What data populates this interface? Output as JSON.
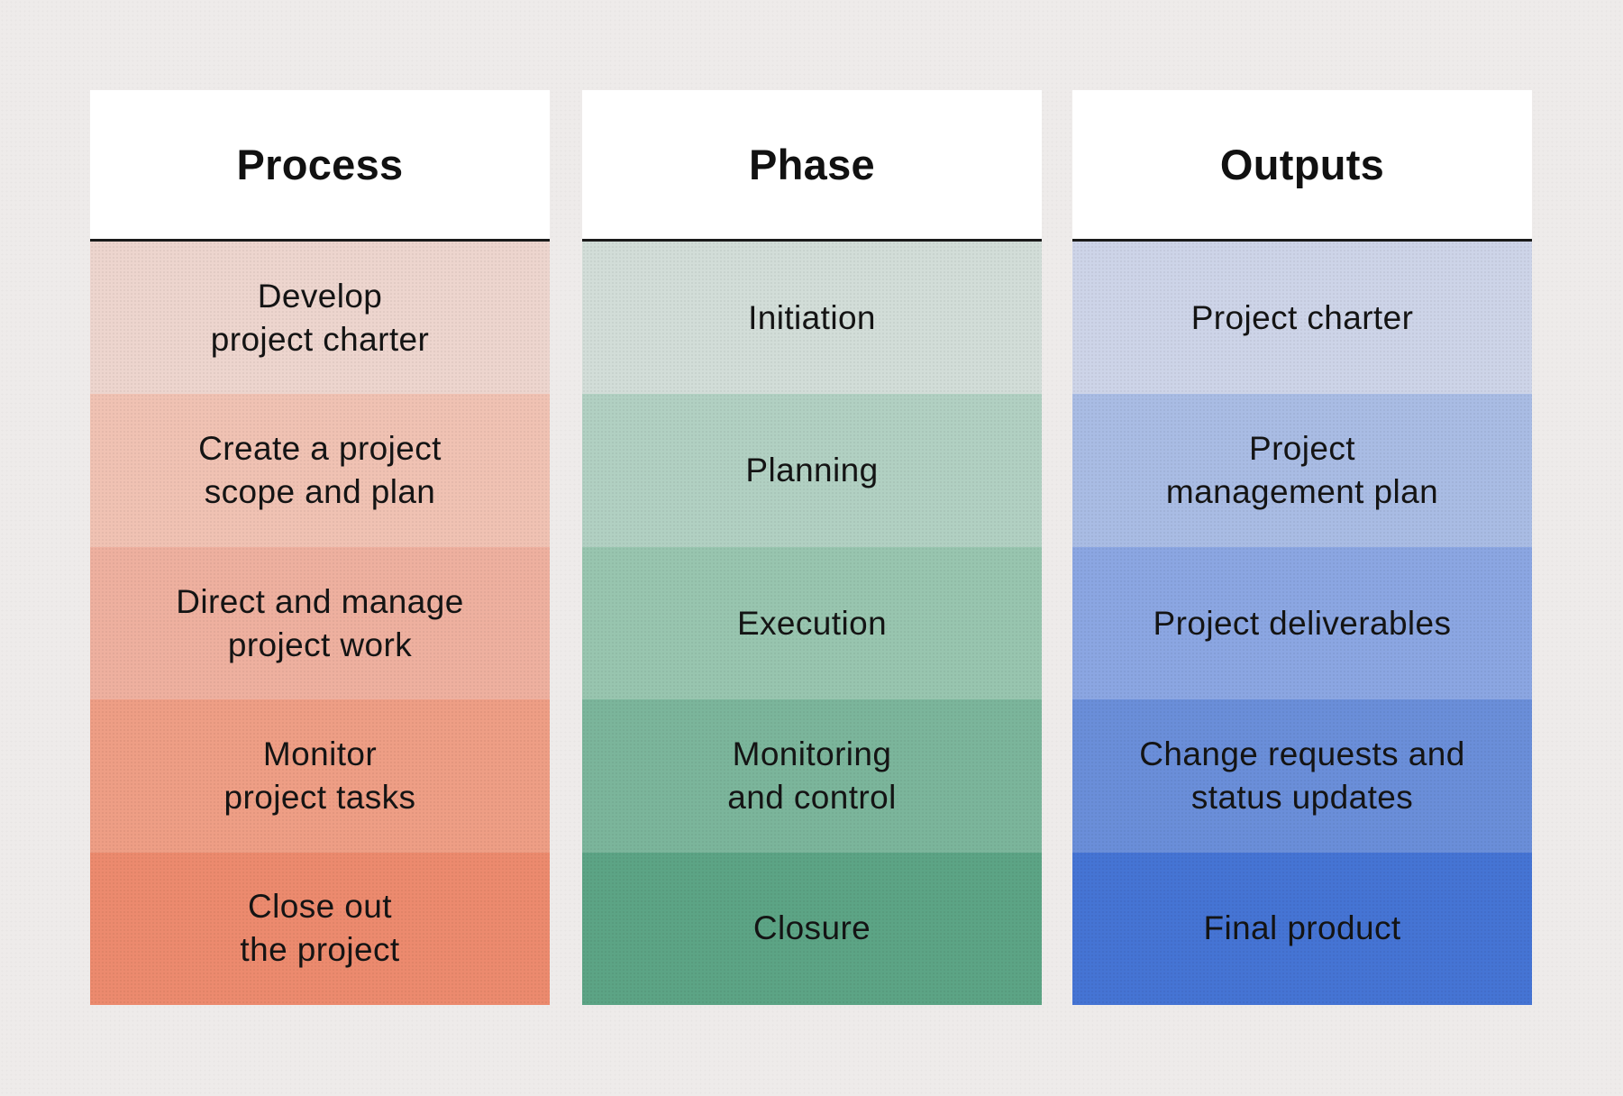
{
  "columns": [
    {
      "id": "process",
      "header": "Process",
      "rows": [
        {
          "text": "Develop\nproject charter",
          "color": "#EDD5CE"
        },
        {
          "text": "Create a project\nscope and plan",
          "color": "#F0C2B3"
        },
        {
          "text": "Direct and manage\nproject work",
          "color": "#EEB09F"
        },
        {
          "text": "Monitor\nproject tasks",
          "color": "#EE9E85"
        },
        {
          "text": "Close out\nthe project",
          "color": "#EC8A6E"
        }
      ]
    },
    {
      "id": "phase",
      "header": "Phase",
      "rows": [
        {
          "text": "Initiation",
          "color": "#D2DDD8"
        },
        {
          "text": "Planning",
          "color": "#B1D0C2"
        },
        {
          "text": "Execution",
          "color": "#98C5AF"
        },
        {
          "text": "Monitoring\nand control",
          "color": "#7BB59B"
        },
        {
          "text": "Closure",
          "color": "#5CA485"
        }
      ]
    },
    {
      "id": "outputs",
      "header": "Outputs",
      "rows": [
        {
          "text": "Project charter",
          "color": "#CDD4E8"
        },
        {
          "text": "Project\nmanagement plan",
          "color": "#A9BCE4"
        },
        {
          "text": "Project deliverables",
          "color": "#8BA6E2"
        },
        {
          "text": "Change requests and\nstatus updates",
          "color": "#6A8ED9"
        },
        {
          "text": "Final product",
          "color": "#4574D4"
        }
      ]
    }
  ]
}
